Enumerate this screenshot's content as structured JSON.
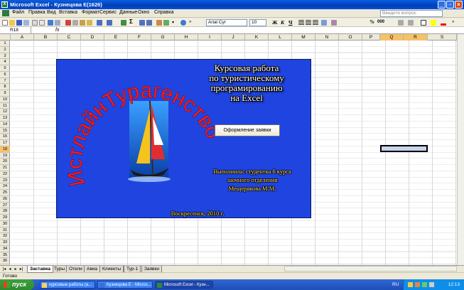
{
  "window": {
    "title": "Microsoft Excel - Кузнецова Е(1626)"
  },
  "menu": [
    "Файл",
    "Правка",
    "Вид",
    "Вставка",
    "Формат",
    "Сервис",
    "Данные",
    "Окно",
    "Справка"
  ],
  "help_placeholder": "Введите вопрос",
  "toolbar": {
    "font_name": "Arial Cyr",
    "font_size": "10",
    "bold": "Ж",
    "italic": "К",
    "underline": "Ч",
    "percent": "%",
    "thousands": "000"
  },
  "namebox": "R18",
  "fx": "fx",
  "columns": [
    "A",
    "B",
    "C",
    "D",
    "E",
    "F",
    "G",
    "H",
    "I",
    "J",
    "K",
    "L",
    "M",
    "N",
    "O",
    "P",
    "Q",
    "R",
    "S"
  ],
  "rows": [
    "1",
    "2",
    "3",
    "4",
    "5",
    "6",
    "7",
    "8",
    "9",
    "10",
    "11",
    "12",
    "13",
    "14",
    "15",
    "16",
    "17",
    "18",
    "19",
    "20",
    "21",
    "22",
    "23",
    "24",
    "25",
    "26",
    "27",
    "28",
    "29",
    "30",
    "31",
    "32",
    "33",
    "34",
    "35",
    "36",
    "37"
  ],
  "splash": {
    "title_lines": [
      "Курсовая работа",
      "по туристическому",
      "програмированию",
      "на Excel"
    ],
    "arc_text": "ИстлайнТурагенство",
    "order_button": "Оформление заявки",
    "author_lines": [
      "Выполнила: студентка 6 курса",
      "заочного отделения",
      "Мещерякова М.М."
    ],
    "city_year": "Воскресенск, 2010 г."
  },
  "sheets": [
    "Заставка",
    "Туры",
    "Отели",
    "Авиа",
    "Клиенты",
    "Тур-1",
    "Заявки"
  ],
  "active_sheet": "Заставка",
  "status": "Готово",
  "taskbar": {
    "start": "пуск",
    "tasks": [
      "курсовые работы (а...",
      "Кузнецова Е - Micros...",
      "Microsoft Excel - Кузн..."
    ],
    "lang": "RU",
    "clock": "12:13"
  }
}
